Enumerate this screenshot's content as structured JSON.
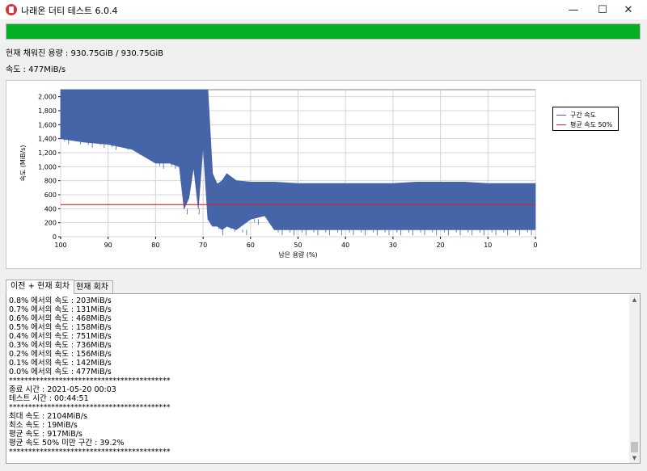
{
  "window": {
    "title": "나래온 더티 테스트 6.0.4",
    "minimize": "—",
    "maximize": "☐",
    "close": "✕",
    "icon": "app-logo-icon"
  },
  "progress": {
    "value": 100
  },
  "status": {
    "capacity": "현재 채워진 용량 : 930.75GiB / 930.75GiB",
    "speed": "속도 : 477MiB/s"
  },
  "chart_data": {
    "type": "line",
    "xlabel": "남은 용량 (%)",
    "ylabel": "속도 (MiB/s)",
    "x_ticks": [
      "100",
      "90",
      "80",
      "70",
      "60",
      "50",
      "40",
      "30",
      "20",
      "10",
      "0"
    ],
    "y_ticks": [
      "2,000",
      "1,800",
      "1,600",
      "1,400",
      "1,200",
      "1,000",
      "800",
      "600",
      "400",
      "200",
      "0"
    ],
    "xlim": [
      100,
      0
    ],
    "ylim": [
      0,
      2100
    ],
    "grid": true,
    "legend": "right",
    "series": [
      {
        "name": "구간 속도",
        "color": "#4664a8",
        "x": [
          100,
          95,
          90,
          85,
          80,
          77,
          75,
          74,
          73,
          72,
          71,
          70,
          69,
          68,
          67,
          66,
          65,
          63,
          60,
          57,
          55,
          50,
          45,
          40,
          35,
          30,
          25,
          20,
          15,
          10,
          5,
          0
        ],
        "lo": [
          1400,
          1350,
          1320,
          1250,
          1050,
          1050,
          1000,
          400,
          550,
          1000,
          400,
          1300,
          250,
          150,
          150,
          100,
          150,
          100,
          250,
          300,
          100,
          100,
          100,
          100,
          100,
          100,
          100,
          100,
          100,
          100,
          100,
          100
        ],
        "hi": [
          2100,
          2100,
          2100,
          2100,
          2100,
          2100,
          2100,
          2100,
          2100,
          2100,
          2100,
          2100,
          2100,
          900,
          750,
          800,
          900,
          800,
          780,
          780,
          780,
          760,
          760,
          760,
          760,
          760,
          780,
          780,
          780,
          760,
          760,
          760
        ]
      },
      {
        "name": "평균 속도 50%",
        "color": "#d62728",
        "value": 458
      }
    ]
  },
  "tabs": [
    {
      "label": "이전 + 현재 회차"
    },
    {
      "label": "현재 회차"
    }
  ],
  "log": [
    "0.8% 에서의 속도 : 203MiB/s",
    "0.7% 에서의 속도 : 131MiB/s",
    "0.6% 에서의 속도 : 468MiB/s",
    "0.5% 에서의 속도 : 158MiB/s",
    "0.4% 에서의 속도 : 751MiB/s",
    "0.3% 에서의 속도 : 736MiB/s",
    "0.2% 에서의 속도 : 156MiB/s",
    "0.1% 에서의 속도 : 142MiB/s",
    "0.0% 에서의 속도 : 477MiB/s",
    "******************************************",
    "종료 시간 : 2021-05-20 00:03",
    "테스트 시간 : 00:44:51",
    "******************************************",
    "최대 속도 : 2104MiB/s",
    "최소 속도 : 19MiB/s",
    "평균 속도 : 917MiB/s",
    "평균 속도 50% 미만 구간 : 39.2%",
    "******************************************"
  ],
  "scroll": {
    "up": "▲",
    "down": "▼"
  }
}
